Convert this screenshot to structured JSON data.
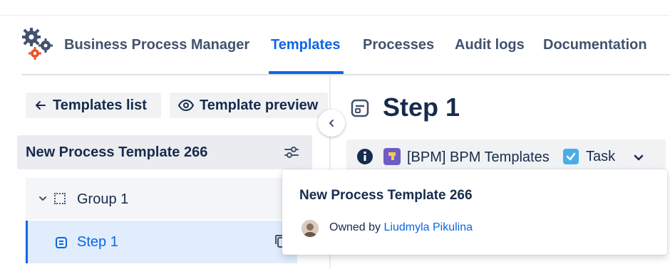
{
  "header": {
    "app_title": "Business Process Manager",
    "tabs": [
      {
        "label": "Templates",
        "active": true
      },
      {
        "label": "Processes",
        "active": false
      },
      {
        "label": "Audit logs",
        "active": false
      },
      {
        "label": "Documentation",
        "active": false
      }
    ],
    "logo_icon": "gears-icon"
  },
  "sidebar": {
    "templates_list_label": "Templates list",
    "template_preview_label": "Template preview",
    "template_name": "New Process Template 266",
    "tree": {
      "group_label": "Group 1",
      "step_label": "Step 1"
    }
  },
  "main": {
    "step_title": "Step 1",
    "issue": {
      "project": "[BPM] BPM Templates",
      "type": "Task"
    }
  },
  "popup": {
    "title": "New Process Template 266",
    "owned_by": "Owned by",
    "owner_name": "Liudmyla Pikulina"
  },
  "colors": {
    "accent": "#0c66e4",
    "text": "#172b4d",
    "subtle_bg": "#f1f2f4",
    "selected_bg": "#e1ecfd",
    "project_icon": "#6e5dc6",
    "task_icon": "#4bade8"
  }
}
